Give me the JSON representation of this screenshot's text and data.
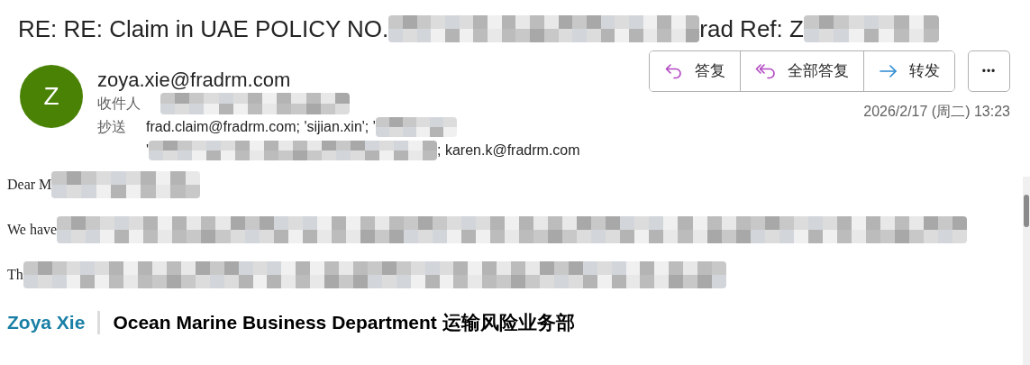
{
  "subject": [
    {
      "kind": "text",
      "text": "RE: RE: Claim in UAE POLICY NO."
    },
    {
      "kind": "redaction"
    },
    {
      "kind": "text",
      "text": "rad Ref: Z"
    },
    {
      "kind": "redaction"
    }
  ],
  "sender": {
    "initial": "Z",
    "color": "#498205",
    "email": "zoya.xie@fradrm.com"
  },
  "to": {
    "label": "收件人",
    "parts": [
      {
        "kind": "redaction"
      }
    ]
  },
  "cc": {
    "label": "抄送",
    "lines": [
      [
        {
          "kind": "text",
          "text": "frad.claim@fradrm.com; 'sijian.xin'; '"
        },
        {
          "kind": "redaction"
        }
      ],
      [
        {
          "kind": "text",
          "text": "'"
        },
        {
          "kind": "redaction"
        },
        {
          "kind": "text",
          "text": "; karen.k@fradrm.com"
        }
      ]
    ]
  },
  "actions": [
    {
      "kind": "reply",
      "label": "答复"
    },
    {
      "kind": "reply_all",
      "label": "全部答复"
    },
    {
      "kind": "forward",
      "label": "转发"
    }
  ],
  "more": "•••",
  "date": "2026/2/17 (周二) 13:23",
  "body": [
    [
      {
        "kind": "text",
        "text": "Dear M"
      },
      {
        "kind": "redaction"
      }
    ],
    [
      {
        "kind": "text",
        "text": "We have"
      },
      {
        "kind": "redaction"
      }
    ],
    [
      {
        "kind": "text",
        "text": "Th"
      },
      {
        "kind": "redaction"
      }
    ]
  ],
  "signature": {
    "name": "Zoya Xie",
    "department": "Ocean Marine Business Department 运输风险业务部"
  }
}
